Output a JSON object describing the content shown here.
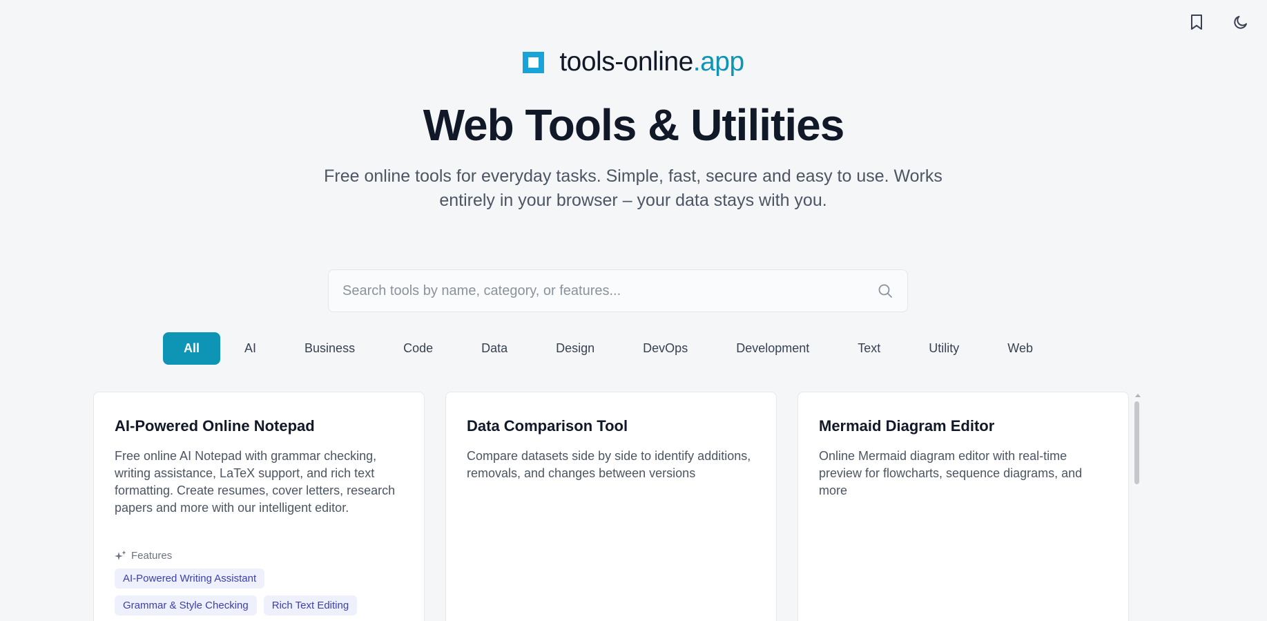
{
  "header": {
    "actions": [
      {
        "name": "bookmark-icon"
      },
      {
        "name": "moon-icon"
      }
    ]
  },
  "brand": {
    "name": "tools-online",
    "tld": ".app",
    "logo_color": "#1aa3d9",
    "accent": "#0e94b5"
  },
  "hero": {
    "title": "Web Tools & Utilities",
    "subtitle": "Free online tools for everyday tasks. Simple, fast, secure and easy to use. Works entirely in your browser – your data stays with you."
  },
  "search": {
    "placeholder": "Search tools by name, category, or features...",
    "value": "",
    "icon": "search-icon"
  },
  "categories": {
    "active": "All",
    "items": [
      "All",
      "AI",
      "Business",
      "Code",
      "Data",
      "Design",
      "DevOps",
      "Development",
      "Text",
      "Utility",
      "Web"
    ]
  },
  "cards": [
    {
      "title": "AI-Powered Online Notepad",
      "description": "Free online AI Notepad with grammar checking, writing assistance, LaTeX support, and rich text formatting. Create resumes, cover letters, research papers and more with our intelligent editor.",
      "features_label": "Features",
      "features": [
        "AI-Powered Writing Assistant",
        "Grammar & Style Checking",
        "Rich Text Editing"
      ]
    },
    {
      "title": "Data Comparison Tool",
      "description": "Compare datasets side by side to identify additions, removals, and changes between versions"
    },
    {
      "title": "Mermaid Diagram Editor",
      "description": "Online Mermaid diagram editor with real-time preview for flowcharts, sequence diagrams, and more"
    }
  ]
}
